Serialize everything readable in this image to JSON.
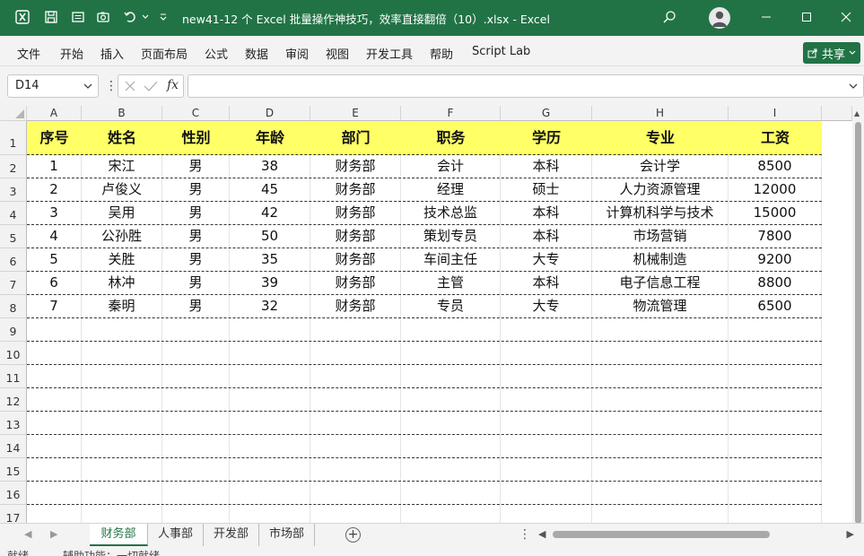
{
  "titlebar": {
    "file_title": "new41-12 个 Excel 批量操作神技巧，效率直接翻倍（10）.xlsx",
    "app_name": "Excel"
  },
  "menu": {
    "items": [
      "文件",
      "开始",
      "插入",
      "页面布局",
      "公式",
      "数据",
      "审阅",
      "视图",
      "开发工具",
      "帮助",
      "Script Lab"
    ],
    "share_label": "共享"
  },
  "formula_bar": {
    "name_box": "D14",
    "fx_label": "fx",
    "formula_value": ""
  },
  "grid": {
    "columns": [
      "A",
      "B",
      "C",
      "D",
      "E",
      "F",
      "G",
      "H",
      "I"
    ],
    "rows": [
      "1",
      "2",
      "3",
      "4",
      "5",
      "6",
      "7",
      "8",
      "9",
      "10",
      "11",
      "12",
      "13",
      "14",
      "15",
      "16",
      "17"
    ],
    "header": [
      "序号",
      "姓名",
      "性别",
      "年龄",
      "部门",
      "职务",
      "学历",
      "专业",
      "工资"
    ],
    "data": [
      [
        "1",
        "宋江",
        "男",
        "38",
        "财务部",
        "会计",
        "本科",
        "会计学",
        "8500"
      ],
      [
        "2",
        "卢俊义",
        "男",
        "45",
        "财务部",
        "经理",
        "硕士",
        "人力资源管理",
        "12000"
      ],
      [
        "3",
        "吴用",
        "男",
        "42",
        "财务部",
        "技术总监",
        "本科",
        "计算机科学与技术",
        "15000"
      ],
      [
        "4",
        "公孙胜",
        "男",
        "50",
        "财务部",
        "策划专员",
        "本科",
        "市场营销",
        "7800"
      ],
      [
        "5",
        "关胜",
        "男",
        "35",
        "财务部",
        "车间主任",
        "大专",
        "机械制造",
        "9200"
      ],
      [
        "6",
        "林冲",
        "男",
        "39",
        "财务部",
        "主管",
        "本科",
        "电子信息工程",
        "8800"
      ],
      [
        "7",
        "秦明",
        "男",
        "32",
        "财务部",
        "专员",
        "大专",
        "物流管理",
        "6500"
      ]
    ],
    "header_fill": "#ffff66"
  },
  "sheets": {
    "tabs": [
      "财务部",
      "人事部",
      "开发部",
      "市场部"
    ],
    "active": "财务部",
    "add_label": "+"
  },
  "statusbar": {
    "mode": "就绪",
    "accessibility": "辅助功能：一切就绪"
  },
  "colors": {
    "accent": "#217346"
  }
}
